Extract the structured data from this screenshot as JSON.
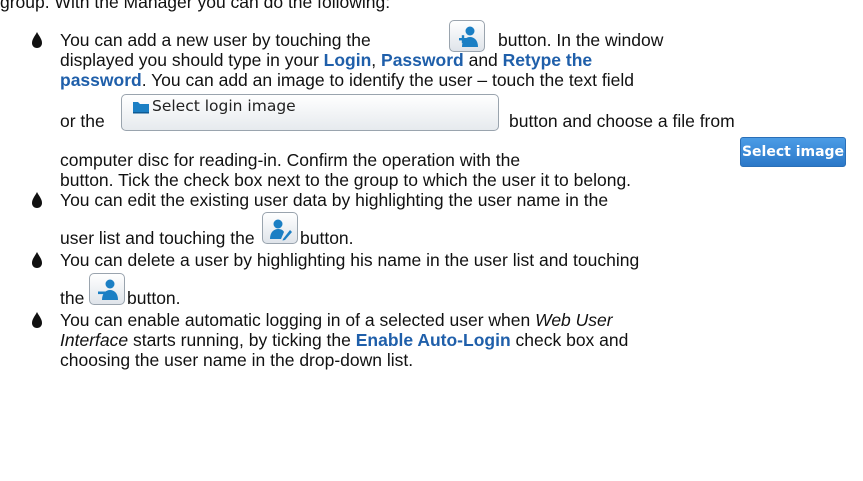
{
  "intro": {
    "fragment": "group. With the Manager you can do the following:"
  },
  "bullets": [
    {
      "id": "add-user",
      "l1_a": "You can add a new user by touching the",
      "l1_b": "button. In the window",
      "l2_a": "displayed you should type in your",
      "login": "Login",
      "comma": ",",
      "password": "Password",
      "and": "and",
      "retype_the": "Retype the",
      "password_word": "password",
      "l3_rest": ". You can add an image to identify the user – touch the text field",
      "l4_a": "or the",
      "l4_b": "button and choose a file from",
      "l5_a": "computer disc for reading-in. Confirm the operation with the",
      "l6": "button. Tick the check box next to the group to which the user it to belong."
    },
    {
      "id": "edit-user",
      "l1": "You can edit the existing user data by highlighting the user name in the",
      "l2_a": "user list and touching the",
      "l2_b": "button."
    },
    {
      "id": "delete-user",
      "l1": "You can delete a user by highlighting his name in the user list and touching",
      "l2_a": "the",
      "l2_b": "button."
    },
    {
      "id": "auto-login",
      "l1_a": "You can enable automatic logging in of a selected user when",
      "web_user": "Web User",
      "interface": "Interface",
      "l2_b": "starts running, by ticking the",
      "enable_auto_login": "Enable Auto-Login",
      "l2_c": "check box and",
      "l3": "choosing the user name in the drop-down list."
    }
  ],
  "buttons": {
    "select_login_image_label": "Select login image",
    "select_image_label": "Select image"
  },
  "icons": {
    "add": "add-user-icon",
    "edit": "edit-user-icon",
    "delete": "delete-user-icon",
    "folder": "folder-icon",
    "bullet": "diamond-bullet-icon"
  },
  "colors": {
    "highlight": "#1f5faa",
    "select_image_button": "#2b78c8",
    "user_icon": "#1b7fc4"
  }
}
